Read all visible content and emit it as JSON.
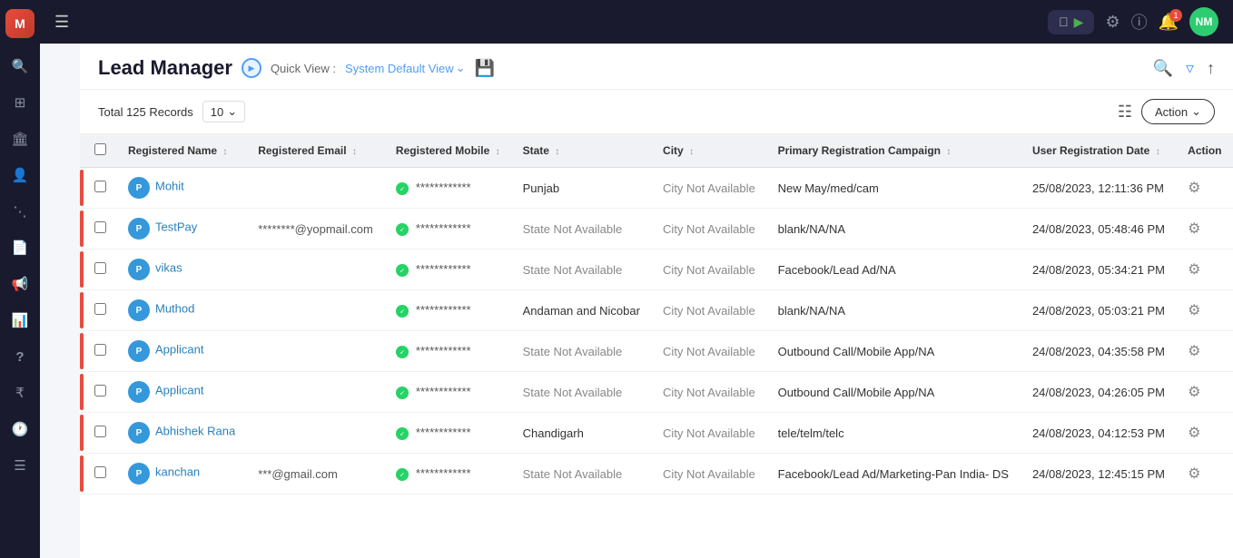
{
  "app": {
    "logo_text": "M",
    "title": "Lead Manager",
    "topbar": {
      "hamburger": "☰",
      "avatar_text": "NM",
      "notif_count": "1"
    }
  },
  "page": {
    "title": "Lead Manager",
    "quick_view_label": "Quick View :",
    "quick_view_value": "System Default View",
    "total_records_label": "Total 125 Records",
    "per_page": "10",
    "action_btn_label": "Action"
  },
  "table": {
    "columns": [
      {
        "id": "registered_name",
        "label": "Registered Name"
      },
      {
        "id": "registered_email",
        "label": "Registered Email"
      },
      {
        "id": "registered_mobile",
        "label": "Registered Mobile"
      },
      {
        "id": "state",
        "label": "State"
      },
      {
        "id": "city",
        "label": "City"
      },
      {
        "id": "primary_campaign",
        "label": "Primary Registration Campaign"
      },
      {
        "id": "reg_date",
        "label": "User Registration Date"
      },
      {
        "id": "action",
        "label": "Action"
      }
    ],
    "rows": [
      {
        "name": "Mohit",
        "email": "",
        "mobile": "************",
        "state": "Punjab",
        "city": "City Not Available",
        "campaign": "New May/med/cam",
        "date": "25/08/2023, 12:11:36 PM"
      },
      {
        "name": "TestPay",
        "email": "********@yopmail.com",
        "mobile": "************",
        "state": "State Not Available",
        "city": "City Not Available",
        "campaign": "blank/NA/NA",
        "date": "24/08/2023, 05:48:46 PM"
      },
      {
        "name": "vikas",
        "email": "",
        "mobile": "************",
        "state": "State Not Available",
        "city": "City Not Available",
        "campaign": "Facebook/Lead Ad/NA",
        "date": "24/08/2023, 05:34:21 PM"
      },
      {
        "name": "Muthod",
        "email": "",
        "mobile": "************",
        "state": "Andaman and Nicobar",
        "city": "City Not Available",
        "campaign": "blank/NA/NA",
        "date": "24/08/2023, 05:03:21 PM"
      },
      {
        "name": "Applicant",
        "email": "",
        "mobile": "************",
        "state": "State Not Available",
        "city": "City Not Available",
        "campaign": "Outbound Call/Mobile App/NA",
        "date": "24/08/2023, 04:35:58 PM"
      },
      {
        "name": "Applicant",
        "email": "",
        "mobile": "************",
        "state": "State Not Available",
        "city": "City Not Available",
        "campaign": "Outbound Call/Mobile App/NA",
        "date": "24/08/2023, 04:26:05 PM"
      },
      {
        "name": "Abhishek Rana",
        "email": "",
        "mobile": "************",
        "state": "Chandigarh",
        "city": "City Not Available",
        "campaign": "tele/telm/telc",
        "date": "24/08/2023, 04:12:53 PM"
      },
      {
        "name": "kanchan",
        "email": "***@gmail.com",
        "mobile": "************",
        "state": "State Not Available",
        "city": "City Not Available",
        "campaign": "Facebook/Lead Ad/Marketing-Pan India- DS",
        "date": "24/08/2023, 12:45:15 PM"
      }
    ]
  },
  "sidebar": {
    "icons": [
      {
        "name": "search-icon",
        "symbol": "🔍"
      },
      {
        "name": "dashboard-icon",
        "symbol": "⊞"
      },
      {
        "name": "building-icon",
        "symbol": "🏛"
      },
      {
        "name": "person-icon",
        "symbol": "👤"
      },
      {
        "name": "network-icon",
        "symbol": "⋰"
      },
      {
        "name": "document-icon",
        "symbol": "📄"
      },
      {
        "name": "megaphone-icon",
        "symbol": "📢"
      },
      {
        "name": "chart-icon",
        "symbol": "📊"
      },
      {
        "name": "help-icon",
        "symbol": "?"
      },
      {
        "name": "rupee-icon",
        "symbol": "₹"
      },
      {
        "name": "clock-icon",
        "symbol": "🕐"
      },
      {
        "name": "list-icon",
        "symbol": "☰"
      }
    ]
  }
}
